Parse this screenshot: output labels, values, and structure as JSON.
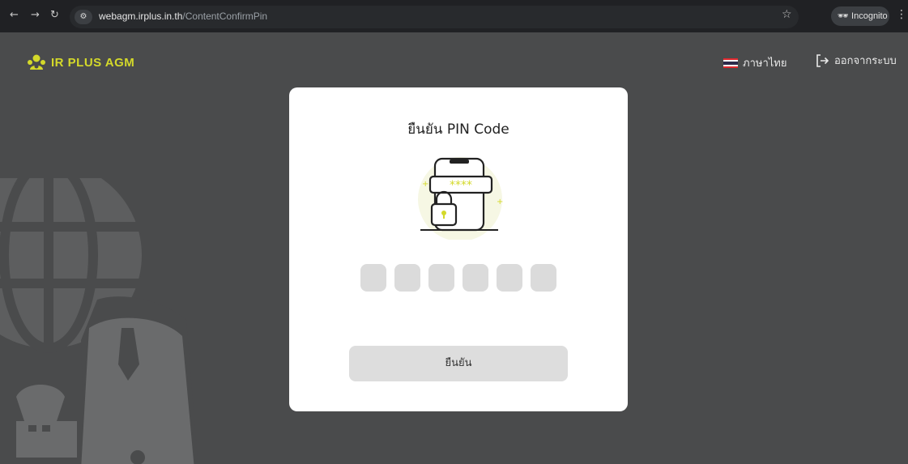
{
  "browser": {
    "url_host": "webagm.irplus.in.th",
    "url_path": "/ContentConfirmPin",
    "incognito_label": "Incognito"
  },
  "header": {
    "logo_text": "IR PLUS AGM",
    "language_label": "ภาษาไทย",
    "logout_label": "ออกจากระบบ"
  },
  "card": {
    "title": "ยืนยัน PIN Code",
    "pin_mask": "****",
    "pin_boxes": [
      "",
      "",
      "",
      "",
      "",
      ""
    ],
    "confirm_label": "ยืนยัน"
  },
  "colors": {
    "page_bg": "#4a4b4c",
    "brand_yellow": "#d4d92a",
    "card_bg": "#ffffff",
    "pin_box": "#dbdbdb",
    "button_bg": "#dddddd"
  }
}
